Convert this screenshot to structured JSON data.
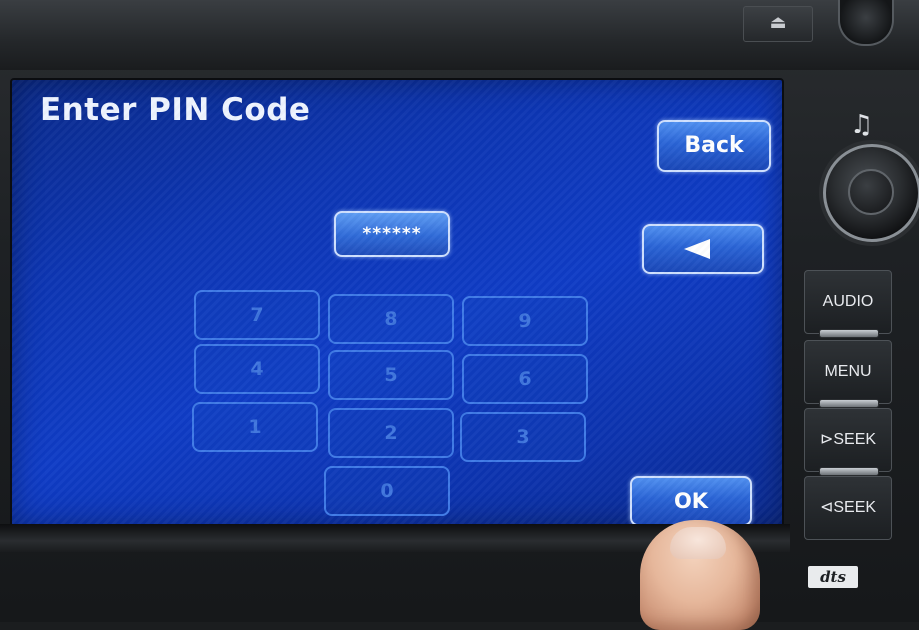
{
  "screen": {
    "title": "Enter PIN Code",
    "back_label": "Back",
    "pin_value": "******",
    "keypad": [
      "7",
      "8",
      "9",
      "4",
      "5",
      "6",
      "1",
      "2",
      "3",
      "0"
    ],
    "ok_label": "OK"
  },
  "hardware": {
    "audio_label": "AUDIO",
    "menu_label": "MENU",
    "seek_forward_label": "⊳SEEK",
    "seek_back_label": "⊲SEEK",
    "dts_label": "dts",
    "eject_icon": "eject-icon",
    "eject_symbol": "⏏",
    "music_note_symbol": "♫"
  },
  "colors": {
    "screen_blue": "#0f3cc6",
    "button_blue": "#2a64d6",
    "key_outline": "#3f7ae6"
  }
}
